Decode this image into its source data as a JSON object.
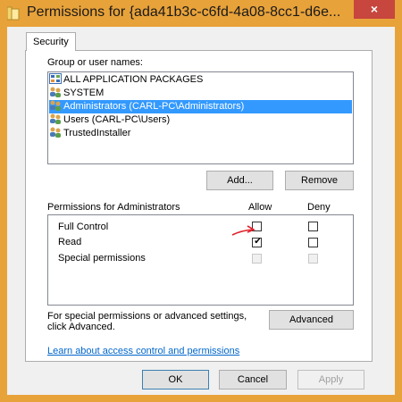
{
  "window": {
    "title": "Permissions for {ada41b3c-c6fd-4a08-8cc1-d6e...",
    "close_label": "×"
  },
  "tabs": [
    {
      "label": "Security"
    }
  ],
  "group_label": "Group or user names:",
  "users": [
    {
      "name": "ALL APPLICATION PACKAGES",
      "icon": "app-packages-icon"
    },
    {
      "name": "SYSTEM",
      "icon": "users-icon"
    },
    {
      "name": "Administrators (CARL-PC\\Administrators)",
      "icon": "users-icon",
      "selected": true
    },
    {
      "name": "Users (CARL-PC\\Users)",
      "icon": "users-icon"
    },
    {
      "name": "TrustedInstaller",
      "icon": "users-icon"
    }
  ],
  "buttons": {
    "add": "Add...",
    "remove": "Remove",
    "advanced": "Advanced",
    "ok": "OK",
    "cancel": "Cancel",
    "apply": "Apply"
  },
  "permissions": {
    "header": "Permissions for Administrators",
    "allow_label": "Allow",
    "deny_label": "Deny",
    "rows": [
      {
        "name": "Full Control",
        "allow": false,
        "deny": false,
        "disabled": false
      },
      {
        "name": "Read",
        "allow": true,
        "deny": false,
        "disabled": false
      },
      {
        "name": "Special permissions",
        "allow": false,
        "deny": false,
        "disabled": true
      }
    ]
  },
  "advanced_text": "For special permissions or advanced settings, click Advanced.",
  "link_text": "Learn about access control and permissions",
  "colors": {
    "title_bar": "#e8a23a",
    "close_button": "#c7463d",
    "selection": "#3399ff",
    "annotation_arrow": "#e0202a"
  }
}
